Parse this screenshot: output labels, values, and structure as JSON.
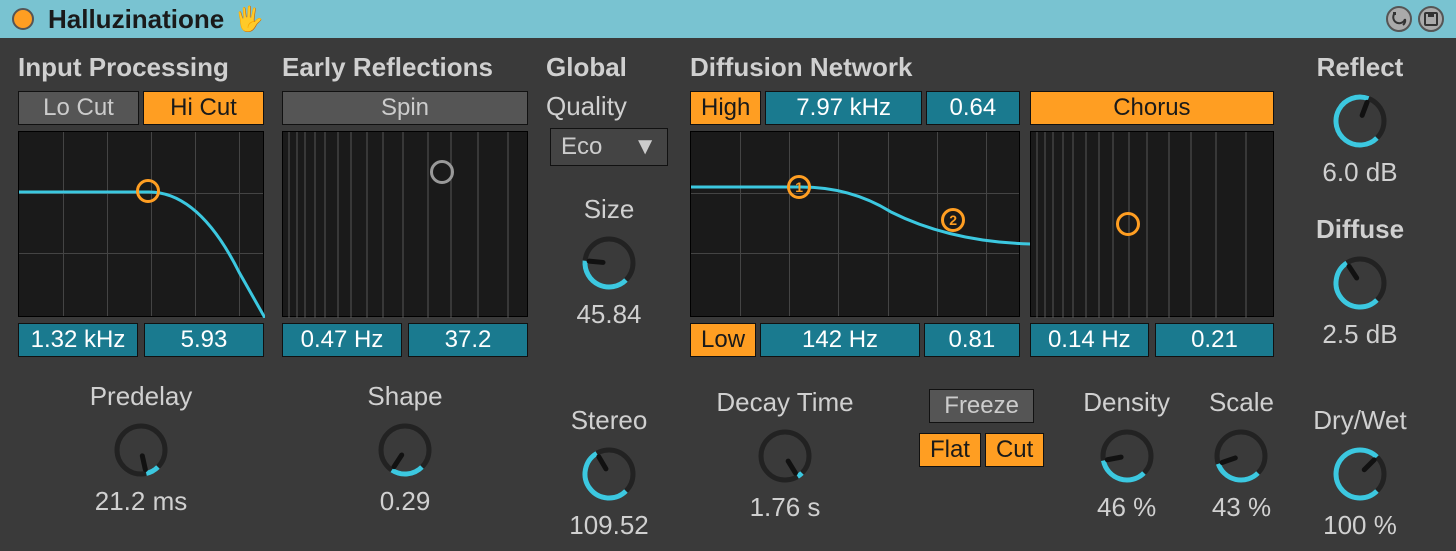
{
  "title": "Halluzinatione",
  "sections": {
    "input": {
      "title": "Input Processing",
      "lo_cut": "Lo Cut",
      "hi_cut": "Hi Cut",
      "freq": "1.32 kHz",
      "amount": "5.93"
    },
    "early": {
      "title": "Early Reflections",
      "spin": "Spin",
      "rate": "0.47 Hz",
      "amount": "37.2"
    },
    "global": {
      "title": "Global",
      "quality_label": "Quality",
      "quality_value": "Eco",
      "size_label": "Size",
      "size_value": "45.84"
    },
    "diffusion": {
      "title": "Diffusion Network",
      "high_label": "High",
      "high_freq": "7.97 kHz",
      "high_amount": "0.64",
      "low_label": "Low",
      "low_freq": "142 Hz",
      "low_amount": "0.81",
      "chorus_label": "Chorus",
      "chorus_rate": "0.14 Hz",
      "chorus_amount": "0.21"
    },
    "output": {
      "reflect_label": "Reflect",
      "reflect_value": "6.0 dB",
      "diffuse_label": "Diffuse",
      "diffuse_value": "2.5 dB"
    }
  },
  "bottom": {
    "predelay_label": "Predelay",
    "predelay_value": "21.2 ms",
    "shape_label": "Shape",
    "shape_value": "0.29",
    "stereo_label": "Stereo",
    "stereo_value": "109.52",
    "decay_label": "Decay Time",
    "decay_value": "1.76 s",
    "freeze_label": "Freeze",
    "flat_label": "Flat",
    "cut_label": "Cut",
    "density_label": "Density",
    "density_value": "46 %",
    "scale_label": "Scale",
    "scale_value": "43 %",
    "drywet_label": "Dry/Wet",
    "drywet_value": "100 %"
  },
  "knob_angles": {
    "size": 0.52,
    "predelay": 0.12,
    "shape": 0.29,
    "stereo": 0.72,
    "decay": 0.05,
    "density": 0.46,
    "scale": 0.43,
    "drywet": 1.0,
    "reflect": 0.91,
    "diffuse": 0.71
  }
}
